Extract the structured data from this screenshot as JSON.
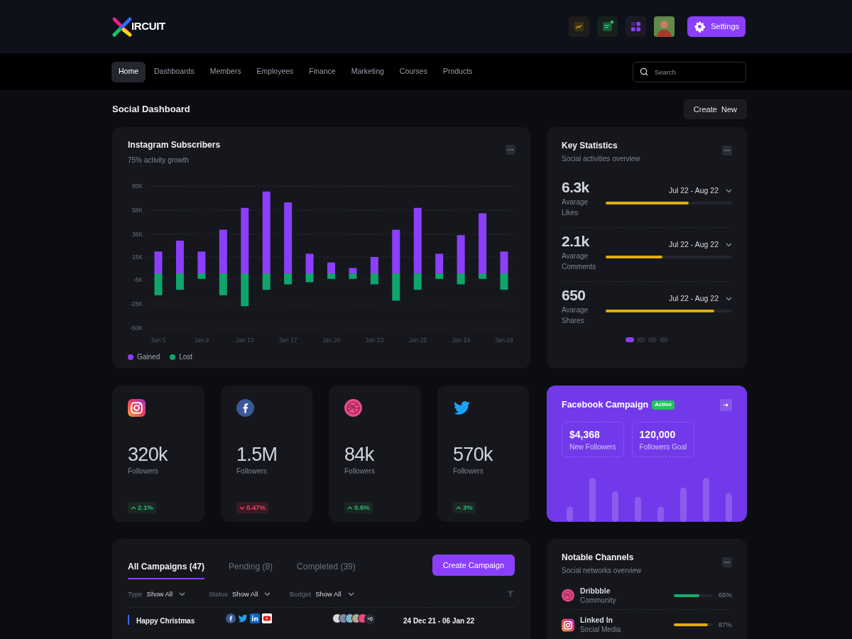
{
  "header": {
    "logo_text": "IRCUIT",
    "icon_buttons": [
      {
        "kind": "chart"
      },
      {
        "kind": "message"
      },
      {
        "kind": "apps"
      }
    ],
    "settings_button": "Settings"
  },
  "nav": {
    "items": [
      {
        "label": "Home",
        "selected": true
      },
      {
        "label": "Dashboards",
        "selected": false
      },
      {
        "label": "Members",
        "selected": false
      },
      {
        "label": "Employees",
        "selected": false
      },
      {
        "label": "Finance",
        "selected": false
      },
      {
        "label": "Marketing",
        "selected": false
      },
      {
        "label": "Courses",
        "selected": false
      },
      {
        "label": "Products",
        "selected": false
      }
    ],
    "search": {
      "placeholder": "Search"
    }
  },
  "page": {
    "title": "Social Dashboard",
    "create_button": "Create  New"
  },
  "subscribers_card": {
    "title": "Instagram Subscribers",
    "subtitle": "75% activity growth",
    "chart_data": {
      "type": "bar",
      "stacked": true,
      "grid": true,
      "categories": [
        "Jan 5",
        null,
        "Jan 9",
        null,
        "Jan 13",
        null,
        "Jan 17",
        null,
        "Jan 20",
        null,
        "Jan 23",
        null,
        "Jan 25",
        null,
        "Jan 24",
        null,
        "Jan 29"
      ],
      "ylim": [
        -50,
        80
      ],
      "yticks": [
        {
          "value": 80,
          "label": "80K"
        },
        {
          "value": 58,
          "label": "58K"
        },
        {
          "value": 36,
          "label": "36K"
        },
        {
          "value": 15,
          "label": "15K"
        },
        {
          "value": -6,
          "label": "-6K"
        },
        {
          "value": -28,
          "label": "-28K"
        },
        {
          "value": -50,
          "label": "-50K"
        }
      ],
      "series": [
        {
          "name": "Gained",
          "color": "#8b3ffc",
          "values": [
            20,
            30,
            20,
            40,
            60,
            75,
            65,
            18,
            10,
            5,
            15,
            40,
            60,
            18,
            35,
            55,
            20
          ]
        },
        {
          "name": "Lost",
          "color": "#0fa56b",
          "values": [
            -20,
            -15,
            -5,
            -20,
            -30,
            -15,
            -10,
            -8,
            -5,
            -5,
            -10,
            -25,
            -15,
            -5,
            -10,
            -5,
            -15
          ]
        }
      ]
    }
  },
  "key_statistics": {
    "title": "Key Statistics",
    "subtitle": "Social activities overview",
    "rows": [
      {
        "value": "6.3k",
        "label": "Avarage Likes",
        "period": "Jul 22 - Aug 22",
        "level": 0.66
      },
      {
        "value": "2.1k",
        "label": "Avarage Comments",
        "period": "Jul 22 - Aug 22",
        "level": 0.45
      },
      {
        "value": "650",
        "label": "Avarage Shares",
        "period": "Jul 22 - Aug 22",
        "level": 0.86
      }
    ],
    "pages": [
      {
        "selected": true
      },
      {
        "selected": false
      },
      {
        "selected": false
      },
      {
        "selected": false
      }
    ]
  },
  "social_cards": [
    {
      "kind": "instagram",
      "value": "320k",
      "label": "Followers",
      "change": "2.1%",
      "positive": true
    },
    {
      "kind": "facebook",
      "value": "1.5M",
      "label": "Followers",
      "change": "0.47%",
      "positive": false
    },
    {
      "kind": "dribbble",
      "value": "84k",
      "label": "Followers",
      "change": "0.6%",
      "positive": true
    },
    {
      "kind": "twitter",
      "value": "570k",
      "label": "Followers",
      "change": "3%",
      "positive": true
    }
  ],
  "facebook_campaign": {
    "title": "Facebook Campaign",
    "badge": "Active",
    "stats": [
      {
        "value": "$4,368",
        "label": "New Followers"
      },
      {
        "value": "120,000",
        "label": "Followers Goal"
      }
    ]
  },
  "campaigns": {
    "tabs": [
      {
        "label": "All Campaigns (47)",
        "selected": true
      },
      {
        "label": "Pending (8)",
        "selected": false
      },
      {
        "label": "Completed (39)",
        "selected": false
      }
    ],
    "create_button": "Create Campaign",
    "filters": [
      {
        "label": "Type",
        "value": "Show All"
      },
      {
        "label": "Status",
        "value": "Show All"
      },
      {
        "label": "Budget",
        "value": "Show All"
      }
    ],
    "rows": [
      {
        "name": "Happy Christmas",
        "channels": [
          {
            "kind": "facebook"
          },
          {
            "kind": "twitter"
          },
          {
            "kind": "linkedin"
          },
          {
            "kind": "youtube"
          }
        ],
        "more_members": "+6",
        "dates": "24 Dec 21 - 06 Jan 22"
      }
    ]
  },
  "notable_channels": {
    "title": "Notable Channels",
    "subtitle": "Social networks overview",
    "rows": [
      {
        "kind": "dribbble",
        "name": "Dribbble",
        "category": "Community",
        "level": 0.65,
        "percent": "65%",
        "color": "#10b068"
      },
      {
        "kind": "instagram",
        "name": "Linked In",
        "category": "Social Media",
        "level": 0.87,
        "percent": "87%",
        "color": "#e0ad0b"
      }
    ]
  }
}
